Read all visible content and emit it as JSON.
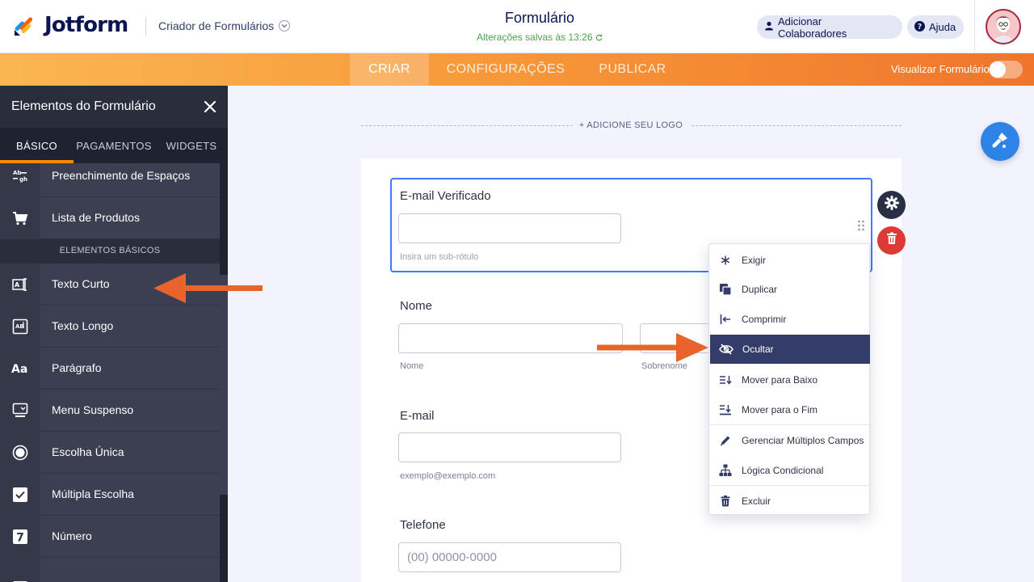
{
  "header": {
    "brand": "Jotform",
    "creator_label": "Criador de Formulários",
    "form_title": "Formulário",
    "saved_status": "Alterações salvas às 13:26",
    "collab_button": "Adicionar Colaboradores",
    "help_button": "Ajuda"
  },
  "nav": {
    "tabs": [
      {
        "label": "CRIAR",
        "active": true
      },
      {
        "label": "CONFIGURAÇÕES",
        "active": false
      },
      {
        "label": "PUBLICAR",
        "active": false
      }
    ],
    "preview_label": "Visualizar Formulário",
    "preview_enabled": false
  },
  "sidebar": {
    "title": "Elementos do Formulário",
    "tabs": [
      {
        "label": "BÁSICO",
        "active": true
      },
      {
        "label": "PAGAMENTOS",
        "active": false
      },
      {
        "label": "WIDGETS",
        "active": false
      }
    ],
    "items_top": [
      {
        "label": "Preenchimento de Espaços",
        "icon": "fill-blank-icon"
      },
      {
        "label": "Lista de Produtos",
        "icon": "cart-icon"
      }
    ],
    "section_label": "ELEMENTOS BÁSICOS",
    "items": [
      {
        "label": "Texto Curto",
        "icon": "short-text-icon"
      },
      {
        "label": "Texto Longo",
        "icon": "long-text-icon"
      },
      {
        "label": "Parágrafo",
        "icon": "paragraph-icon"
      },
      {
        "label": "Menu Suspenso",
        "icon": "dropdown-icon"
      },
      {
        "label": "Escolha Única",
        "icon": "radio-icon"
      },
      {
        "label": "Múltipla Escolha",
        "icon": "checkbox-icon"
      },
      {
        "label": "Número",
        "icon": "number-icon"
      }
    ]
  },
  "canvas": {
    "add_logo": "+ ADICIONE SEU LOGO",
    "fields": {
      "verified_email": {
        "label": "E-mail Verificado",
        "sublabel": "Insira um sub-rótulo"
      },
      "name": {
        "label": "Nome",
        "first_sub": "Nome",
        "last_sub": "Sobrenome"
      },
      "email": {
        "label": "E-mail",
        "sublabel": "exemplo@exemplo.com"
      },
      "phone": {
        "label": "Telefone",
        "placeholder": "(00) 00000-0000"
      }
    }
  },
  "context_menu": {
    "items": [
      {
        "label": "Exigir",
        "icon": "asterisk-icon"
      },
      {
        "label": "Duplicar",
        "icon": "duplicate-icon"
      },
      {
        "label": "Comprimir",
        "icon": "shrink-icon"
      },
      {
        "label": "Ocultar",
        "icon": "eye-slash-icon",
        "active": true
      },
      {
        "label": "Mover para Baixo",
        "icon": "move-down-icon"
      },
      {
        "label": "Mover para o Fim",
        "icon": "move-end-icon"
      },
      {
        "label": "Gerenciar Múltiplos Campos",
        "icon": "pencil-icon"
      },
      {
        "label": "Lógica Condicional",
        "icon": "logic-icon"
      },
      {
        "label": "Excluir",
        "icon": "trash-icon"
      }
    ]
  },
  "colors": {
    "brand_orange": "#f79a3a",
    "navy": "#0a1551",
    "accent_blue": "#4277ff",
    "delete_red": "#dc3a35",
    "arrow": "#e8642c"
  }
}
